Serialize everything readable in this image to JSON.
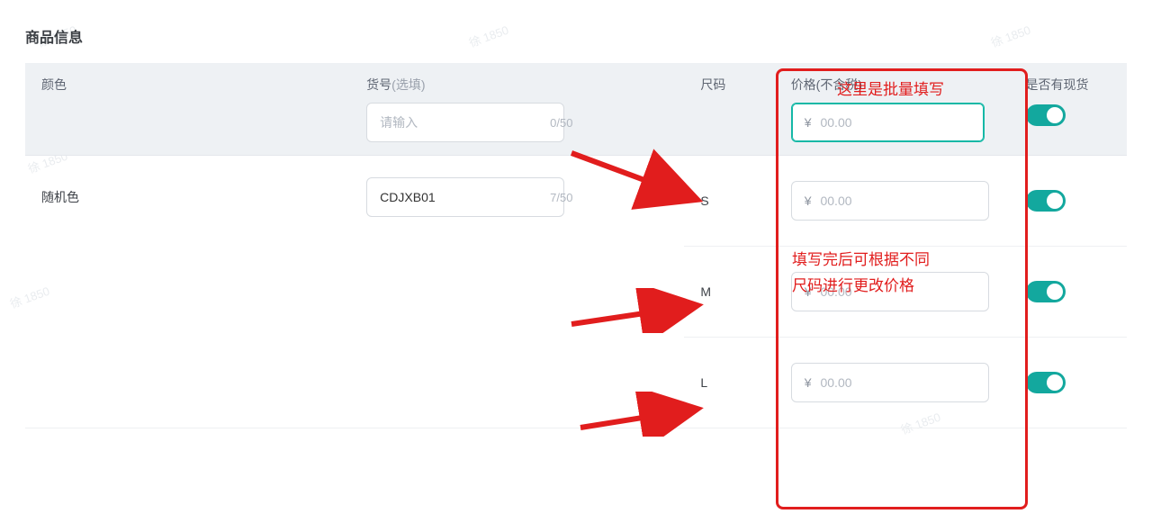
{
  "watermark": "徐 1850",
  "section_title": "商品信息",
  "headers": {
    "color": "颜色",
    "sku": "货号",
    "sku_optional": "(选填)",
    "size": "尺码",
    "price": "价格(不含税)",
    "stock": "是否有现货"
  },
  "header_inputs": {
    "sku_placeholder": "请输入",
    "sku_counter": "0/50",
    "price_prefix": "¥",
    "price_placeholder": "00.00"
  },
  "rows": [
    {
      "color": "随机色",
      "sku_value": "CDJXB01",
      "sku_counter": "7/50",
      "size": "S",
      "price_placeholder": "00.00",
      "stock_on": true
    },
    {
      "color": "",
      "sku_value": "",
      "sku_counter": "",
      "size": "M",
      "price_placeholder": "00.00",
      "stock_on": true
    },
    {
      "color": "",
      "sku_value": "",
      "sku_counter": "",
      "size": "L",
      "price_placeholder": "00.00",
      "stock_on": true
    }
  ],
  "annotations": {
    "top": "这里是批量填写",
    "mid_line1": "填写完后可根据不同",
    "mid_line2": "尺码进行更改价格"
  }
}
